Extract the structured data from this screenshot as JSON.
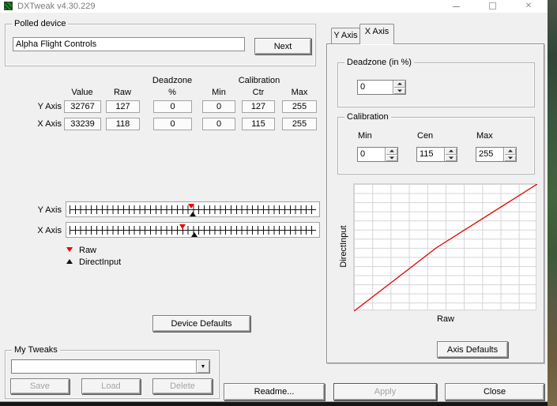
{
  "titlebar": {
    "title": "DXTweak v4.30.229"
  },
  "icons": {
    "close": "✕",
    "combo_arrow": "▼"
  },
  "polled_device": {
    "group_label": "Polled device",
    "device_name": "Alpha Flight Controls",
    "next_button": "Next"
  },
  "axes_table": {
    "deadzone_header": "Deadzone",
    "calibration_header": "Calibration",
    "col_value": "Value",
    "col_raw": "Raw",
    "col_pct": "%",
    "col_min": "Min",
    "col_ctr": "Ctr",
    "col_max": "Max",
    "rows": [
      {
        "label": "Y Axis",
        "value": "32767",
        "raw": "127",
        "deadzone_pct": "0",
        "min": "0",
        "ctr": "127",
        "max": "255"
      },
      {
        "label": "X Axis",
        "value": "33239",
        "raw": "118",
        "deadzone_pct": "0",
        "min": "0",
        "ctr": "115",
        "max": "255"
      }
    ]
  },
  "rulers": {
    "y_label": "Y Axis",
    "x_label": "X Axis",
    "y_raw_pct": 49.4,
    "y_di_pct": 50.0,
    "x_raw_pct": 46.0,
    "x_di_pct": 50.7
  },
  "legend": {
    "raw_label": "Raw",
    "di_label": "DirectInput"
  },
  "buttons": {
    "device_defaults": "Device Defaults",
    "readme": "Readme...",
    "apply": "Apply",
    "close": "Close",
    "axis_defaults": "Axis Defaults"
  },
  "my_tweaks": {
    "group_label": "My Tweaks",
    "combo_value": "",
    "save": "Save",
    "load": "Load",
    "delete": "Delete"
  },
  "tabs": {
    "y": "Y Axis",
    "x": "X Axis",
    "selected": "X Axis"
  },
  "deadzone_panel": {
    "group_label": "Deadzone (in %)",
    "value": "0"
  },
  "calibration_panel": {
    "group_label": "Calibration",
    "min_label": "Min",
    "cen_label": "Cen",
    "max_label": "Max",
    "min": "0",
    "cen": "115",
    "max": "255"
  },
  "graph": {
    "ylabel": "DirectInput",
    "xlabel": "Raw",
    "line_color": "#e00000",
    "line_points_pct": [
      [
        0,
        100
      ],
      [
        45.1,
        50
      ],
      [
        100,
        0
      ]
    ]
  }
}
